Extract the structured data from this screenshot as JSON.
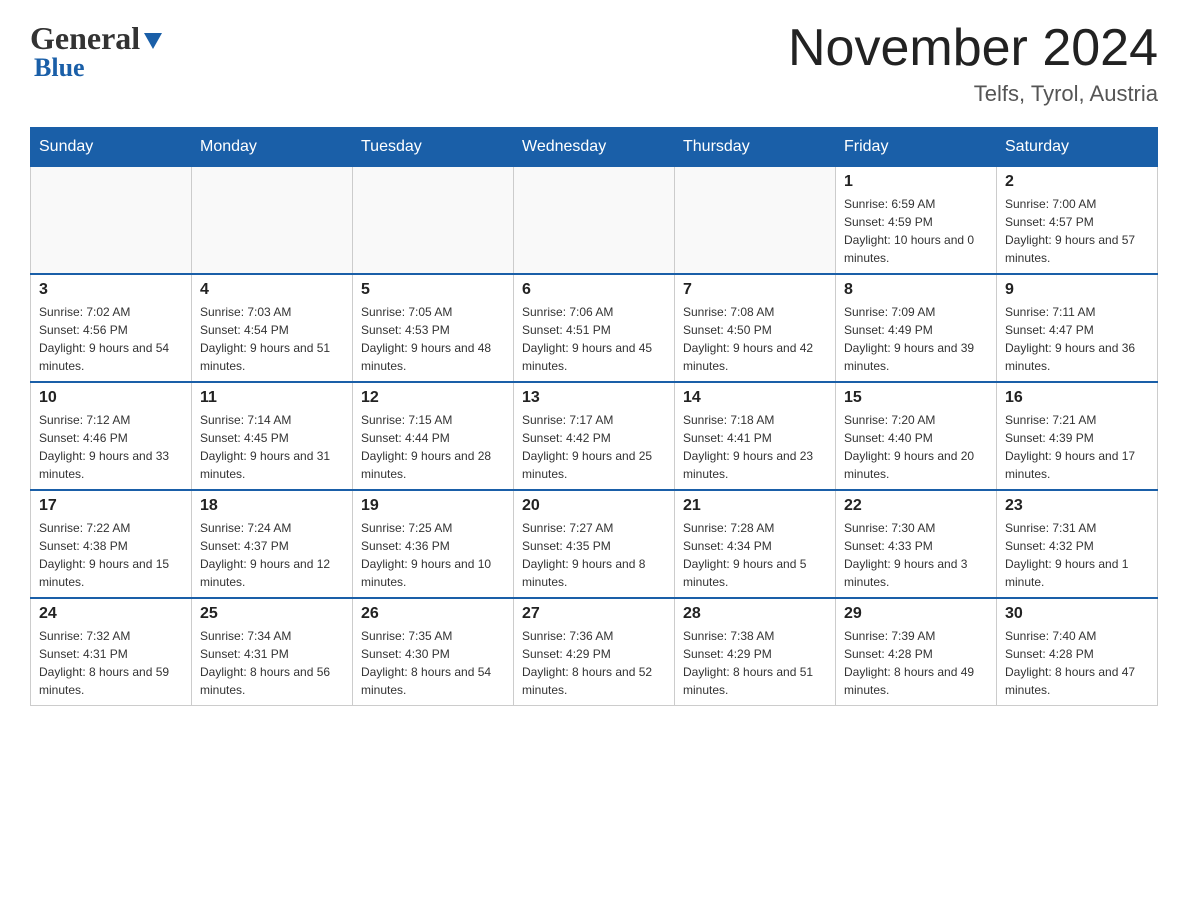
{
  "header": {
    "logo_general": "General",
    "logo_blue": "Blue",
    "month_title": "November 2024",
    "location": "Telfs, Tyrol, Austria"
  },
  "days_of_week": [
    "Sunday",
    "Monday",
    "Tuesday",
    "Wednesday",
    "Thursday",
    "Friday",
    "Saturday"
  ],
  "weeks": [
    {
      "days": [
        {
          "number": "",
          "info": ""
        },
        {
          "number": "",
          "info": ""
        },
        {
          "number": "",
          "info": ""
        },
        {
          "number": "",
          "info": ""
        },
        {
          "number": "",
          "info": ""
        },
        {
          "number": "1",
          "info": "Sunrise: 6:59 AM\nSunset: 4:59 PM\nDaylight: 10 hours and 0 minutes."
        },
        {
          "number": "2",
          "info": "Sunrise: 7:00 AM\nSunset: 4:57 PM\nDaylight: 9 hours and 57 minutes."
        }
      ]
    },
    {
      "days": [
        {
          "number": "3",
          "info": "Sunrise: 7:02 AM\nSunset: 4:56 PM\nDaylight: 9 hours and 54 minutes."
        },
        {
          "number": "4",
          "info": "Sunrise: 7:03 AM\nSunset: 4:54 PM\nDaylight: 9 hours and 51 minutes."
        },
        {
          "number": "5",
          "info": "Sunrise: 7:05 AM\nSunset: 4:53 PM\nDaylight: 9 hours and 48 minutes."
        },
        {
          "number": "6",
          "info": "Sunrise: 7:06 AM\nSunset: 4:51 PM\nDaylight: 9 hours and 45 minutes."
        },
        {
          "number": "7",
          "info": "Sunrise: 7:08 AM\nSunset: 4:50 PM\nDaylight: 9 hours and 42 minutes."
        },
        {
          "number": "8",
          "info": "Sunrise: 7:09 AM\nSunset: 4:49 PM\nDaylight: 9 hours and 39 minutes."
        },
        {
          "number": "9",
          "info": "Sunrise: 7:11 AM\nSunset: 4:47 PM\nDaylight: 9 hours and 36 minutes."
        }
      ]
    },
    {
      "days": [
        {
          "number": "10",
          "info": "Sunrise: 7:12 AM\nSunset: 4:46 PM\nDaylight: 9 hours and 33 minutes."
        },
        {
          "number": "11",
          "info": "Sunrise: 7:14 AM\nSunset: 4:45 PM\nDaylight: 9 hours and 31 minutes."
        },
        {
          "number": "12",
          "info": "Sunrise: 7:15 AM\nSunset: 4:44 PM\nDaylight: 9 hours and 28 minutes."
        },
        {
          "number": "13",
          "info": "Sunrise: 7:17 AM\nSunset: 4:42 PM\nDaylight: 9 hours and 25 minutes."
        },
        {
          "number": "14",
          "info": "Sunrise: 7:18 AM\nSunset: 4:41 PM\nDaylight: 9 hours and 23 minutes."
        },
        {
          "number": "15",
          "info": "Sunrise: 7:20 AM\nSunset: 4:40 PM\nDaylight: 9 hours and 20 minutes."
        },
        {
          "number": "16",
          "info": "Sunrise: 7:21 AM\nSunset: 4:39 PM\nDaylight: 9 hours and 17 minutes."
        }
      ]
    },
    {
      "days": [
        {
          "number": "17",
          "info": "Sunrise: 7:22 AM\nSunset: 4:38 PM\nDaylight: 9 hours and 15 minutes."
        },
        {
          "number": "18",
          "info": "Sunrise: 7:24 AM\nSunset: 4:37 PM\nDaylight: 9 hours and 12 minutes."
        },
        {
          "number": "19",
          "info": "Sunrise: 7:25 AM\nSunset: 4:36 PM\nDaylight: 9 hours and 10 minutes."
        },
        {
          "number": "20",
          "info": "Sunrise: 7:27 AM\nSunset: 4:35 PM\nDaylight: 9 hours and 8 minutes."
        },
        {
          "number": "21",
          "info": "Sunrise: 7:28 AM\nSunset: 4:34 PM\nDaylight: 9 hours and 5 minutes."
        },
        {
          "number": "22",
          "info": "Sunrise: 7:30 AM\nSunset: 4:33 PM\nDaylight: 9 hours and 3 minutes."
        },
        {
          "number": "23",
          "info": "Sunrise: 7:31 AM\nSunset: 4:32 PM\nDaylight: 9 hours and 1 minute."
        }
      ]
    },
    {
      "days": [
        {
          "number": "24",
          "info": "Sunrise: 7:32 AM\nSunset: 4:31 PM\nDaylight: 8 hours and 59 minutes."
        },
        {
          "number": "25",
          "info": "Sunrise: 7:34 AM\nSunset: 4:31 PM\nDaylight: 8 hours and 56 minutes."
        },
        {
          "number": "26",
          "info": "Sunrise: 7:35 AM\nSunset: 4:30 PM\nDaylight: 8 hours and 54 minutes."
        },
        {
          "number": "27",
          "info": "Sunrise: 7:36 AM\nSunset: 4:29 PM\nDaylight: 8 hours and 52 minutes."
        },
        {
          "number": "28",
          "info": "Sunrise: 7:38 AM\nSunset: 4:29 PM\nDaylight: 8 hours and 51 minutes."
        },
        {
          "number": "29",
          "info": "Sunrise: 7:39 AM\nSunset: 4:28 PM\nDaylight: 8 hours and 49 minutes."
        },
        {
          "number": "30",
          "info": "Sunrise: 7:40 AM\nSunset: 4:28 PM\nDaylight: 8 hours and 47 minutes."
        }
      ]
    }
  ]
}
